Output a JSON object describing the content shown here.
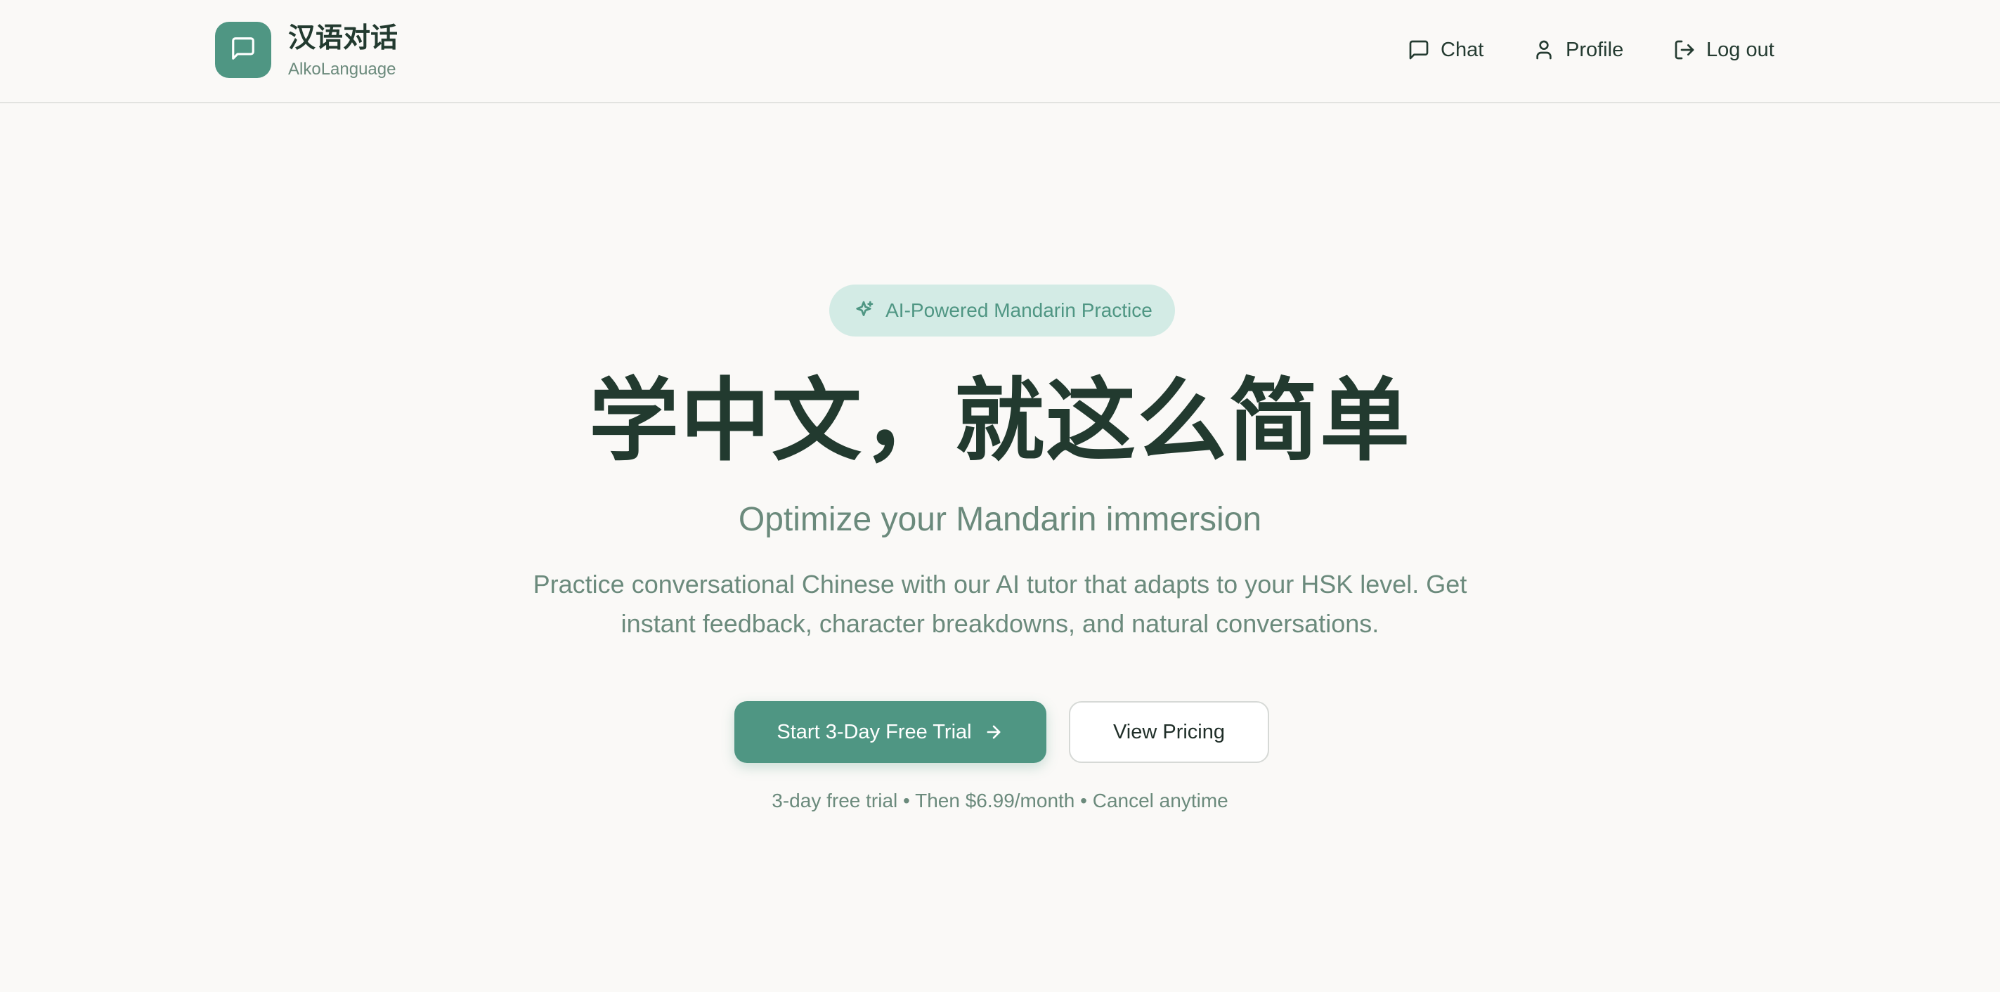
{
  "brand": {
    "title": "汉语对话",
    "subtitle": "AlkoLanguage",
    "logo_icon": "message-square-icon",
    "accent_color": "#4f9683"
  },
  "nav": {
    "items": [
      {
        "label": "Chat",
        "icon": "message-square-icon"
      },
      {
        "label": "Profile",
        "icon": "user-icon"
      },
      {
        "label": "Log out",
        "icon": "log-out-icon"
      }
    ]
  },
  "hero": {
    "badge": {
      "label": "AI-Powered Mandarin Practice",
      "icon": "sparkles-icon",
      "background": "#d3ebe5"
    },
    "title": "学中文，就这么简单",
    "subtitle": "Optimize your Mandarin immersion",
    "description": "Practice conversational Chinese with our AI tutor that adapts to your HSK level. Get instant feedback, character breakdowns, and natural conversations.",
    "primary_cta": {
      "label": "Start 3-Day Free Trial",
      "icon": "arrow-right-icon"
    },
    "secondary_cta": {
      "label": "View Pricing"
    },
    "fine_print": "3-day free trial • Then $6.99/month • Cancel anytime"
  }
}
